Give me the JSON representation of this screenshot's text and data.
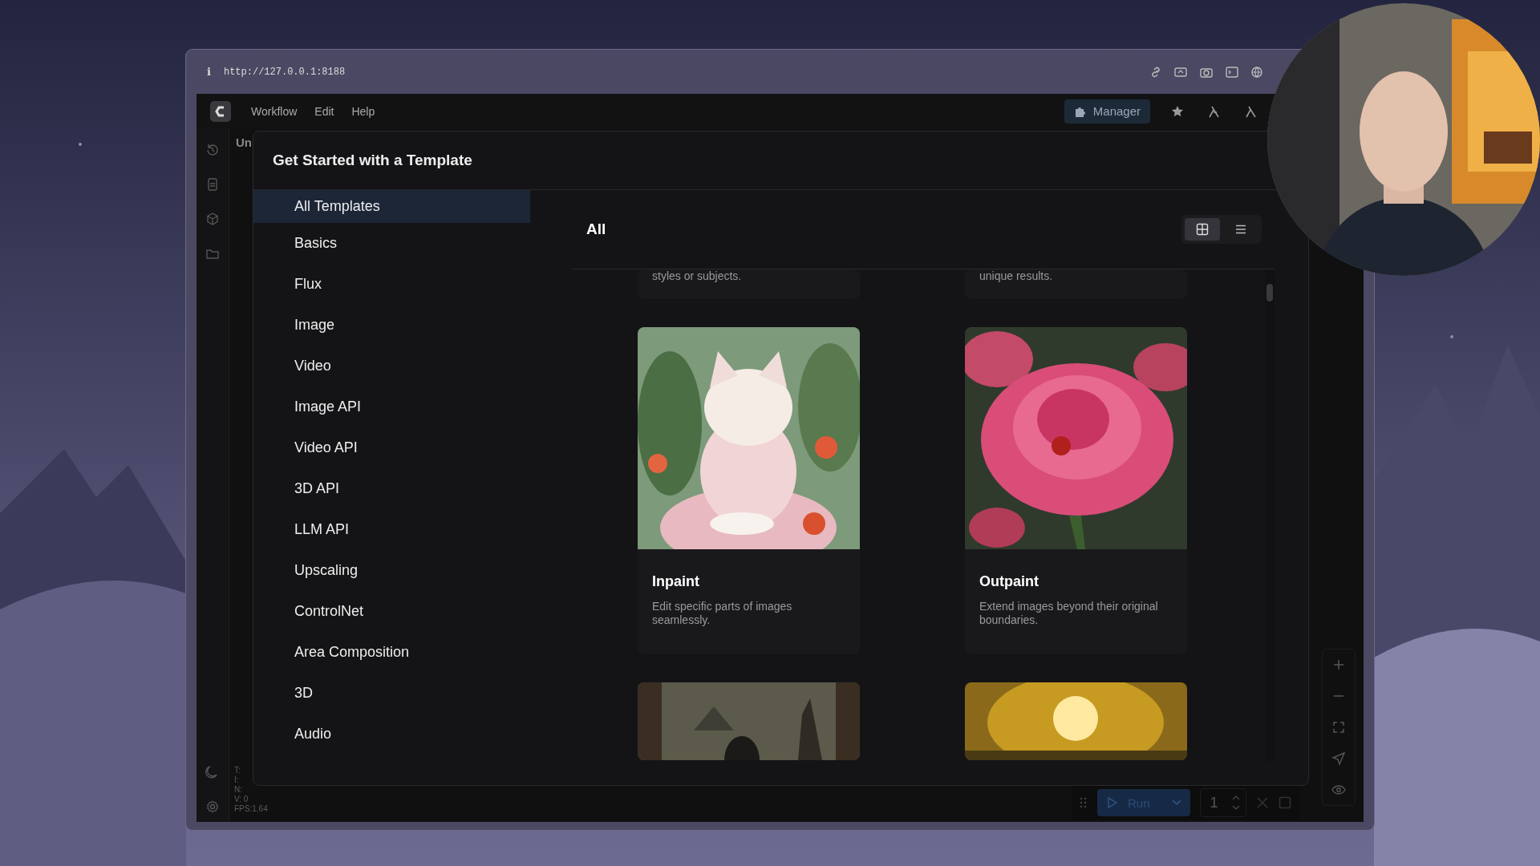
{
  "browser": {
    "info": "i",
    "url": "http://127.0.0.1:8188"
  },
  "menu": [
    {
      "label": "Workflow"
    },
    {
      "label": "Edit"
    },
    {
      "label": "Help"
    }
  ],
  "manager_button": "Manager",
  "tab_label": "Un",
  "stats": [
    "T:",
    "I:",
    "N:",
    "V: 0",
    "FPS:1.64"
  ],
  "dialog": {
    "title": "Get Started with a Template",
    "categories": [
      {
        "label": "All Templates",
        "selected": true
      },
      {
        "label": "Basics",
        "selected": false
      },
      {
        "label": "Flux",
        "selected": false
      },
      {
        "label": "Image",
        "selected": false
      },
      {
        "label": "Video",
        "selected": false
      },
      {
        "label": "Image API",
        "selected": false
      },
      {
        "label": "Video API",
        "selected": false
      },
      {
        "label": "3D API",
        "selected": false
      },
      {
        "label": "LLM API",
        "selected": false
      },
      {
        "label": "Upscaling",
        "selected": false
      },
      {
        "label": "ControlNet",
        "selected": false
      },
      {
        "label": "Area Composition",
        "selected": false
      },
      {
        "label": "3D",
        "selected": false
      },
      {
        "label": "Audio",
        "selected": false
      }
    ],
    "heading": "All",
    "view_modes": [
      {
        "kind": "grid",
        "selected": true
      },
      {
        "kind": "list",
        "selected": false
      }
    ],
    "cards": [
      {
        "kind": "tail",
        "description": "styles or subjects."
      },
      {
        "kind": "tail",
        "description": "unique results."
      },
      {
        "kind": "full",
        "title": "Inpaint",
        "description": "Edit specific parts of images seamlessly."
      },
      {
        "kind": "full",
        "title": "Outpaint",
        "description": "Extend images beyond their original boundaries."
      },
      {
        "kind": "head"
      },
      {
        "kind": "head"
      }
    ]
  },
  "run_bar": {
    "run_label": "Run",
    "count": "1"
  }
}
